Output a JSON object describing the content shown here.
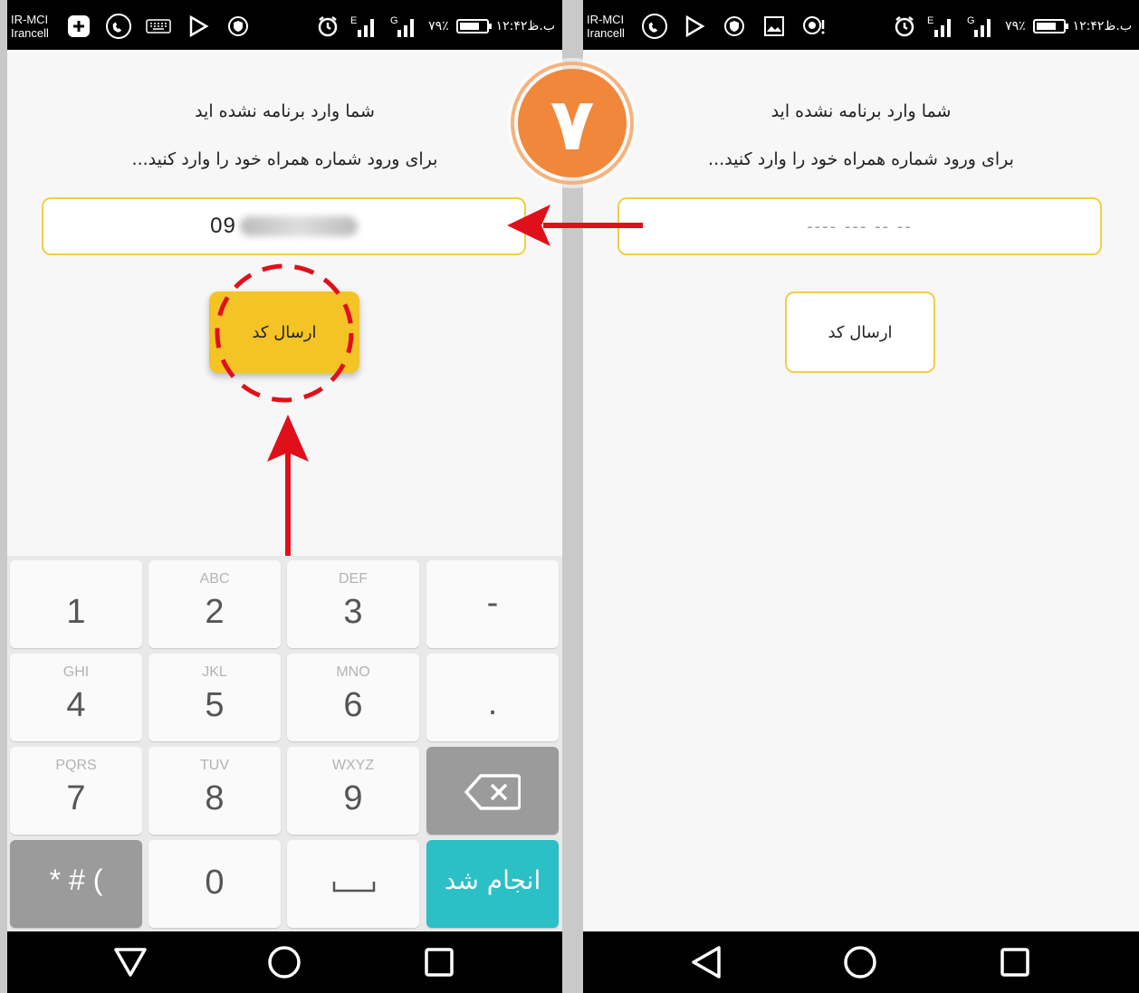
{
  "left_screen": {
    "status": {
      "carrier_line1": "IR-MCI",
      "carrier_line2": "Irancell",
      "network1": "E",
      "network2": "G",
      "battery_text": "۷۹٪",
      "battery_level": 0.79,
      "time": "۱۲:۴۲ب.ظ"
    },
    "title": "شما وارد برنامه نشده اید",
    "subtitle": "برای ورود شماره همراه خود را وارد کنید...",
    "phone_value_visible": "09",
    "send_button_label": "ارسال کد",
    "keypad": {
      "keys": [
        {
          "main": "1",
          "sub": ""
        },
        {
          "main": "2",
          "sub": "ABC"
        },
        {
          "main": "3",
          "sub": "DEF"
        },
        {
          "main": "-",
          "sub": ""
        },
        {
          "main": "4",
          "sub": "GHI"
        },
        {
          "main": "5",
          "sub": "JKL"
        },
        {
          "main": "6",
          "sub": "MNO"
        },
        {
          "main": ".",
          "sub": ""
        },
        {
          "main": "7",
          "sub": "PQRS"
        },
        {
          "main": "8",
          "sub": "TUV"
        },
        {
          "main": "9",
          "sub": "WXYZ"
        },
        {
          "main": "",
          "sub": ""
        },
        {
          "main": "* # (",
          "sub": ""
        },
        {
          "main": "0",
          "sub": ""
        },
        {
          "main": "",
          "sub": ""
        },
        {
          "main": "",
          "sub": ""
        }
      ],
      "done_label": "انجام شد"
    }
  },
  "right_screen": {
    "status": {
      "carrier_line1": "IR-MCI",
      "carrier_line2": "Irancell",
      "network1": "E",
      "network2": "G",
      "battery_text": "۷۹٪",
      "battery_level": 0.79,
      "time": "۱۲:۴۲ب.ظ"
    },
    "title": "شما وارد برنامه نشده اید",
    "subtitle": "برای ورود شماره همراه خود را وارد کنید...",
    "phone_placeholder": "---- --- -- --",
    "send_button_label": "ارسال کد"
  },
  "annotation": {
    "step_number": "۷",
    "badge_color": "#f0873a",
    "arrow_color": "#e0101a"
  }
}
